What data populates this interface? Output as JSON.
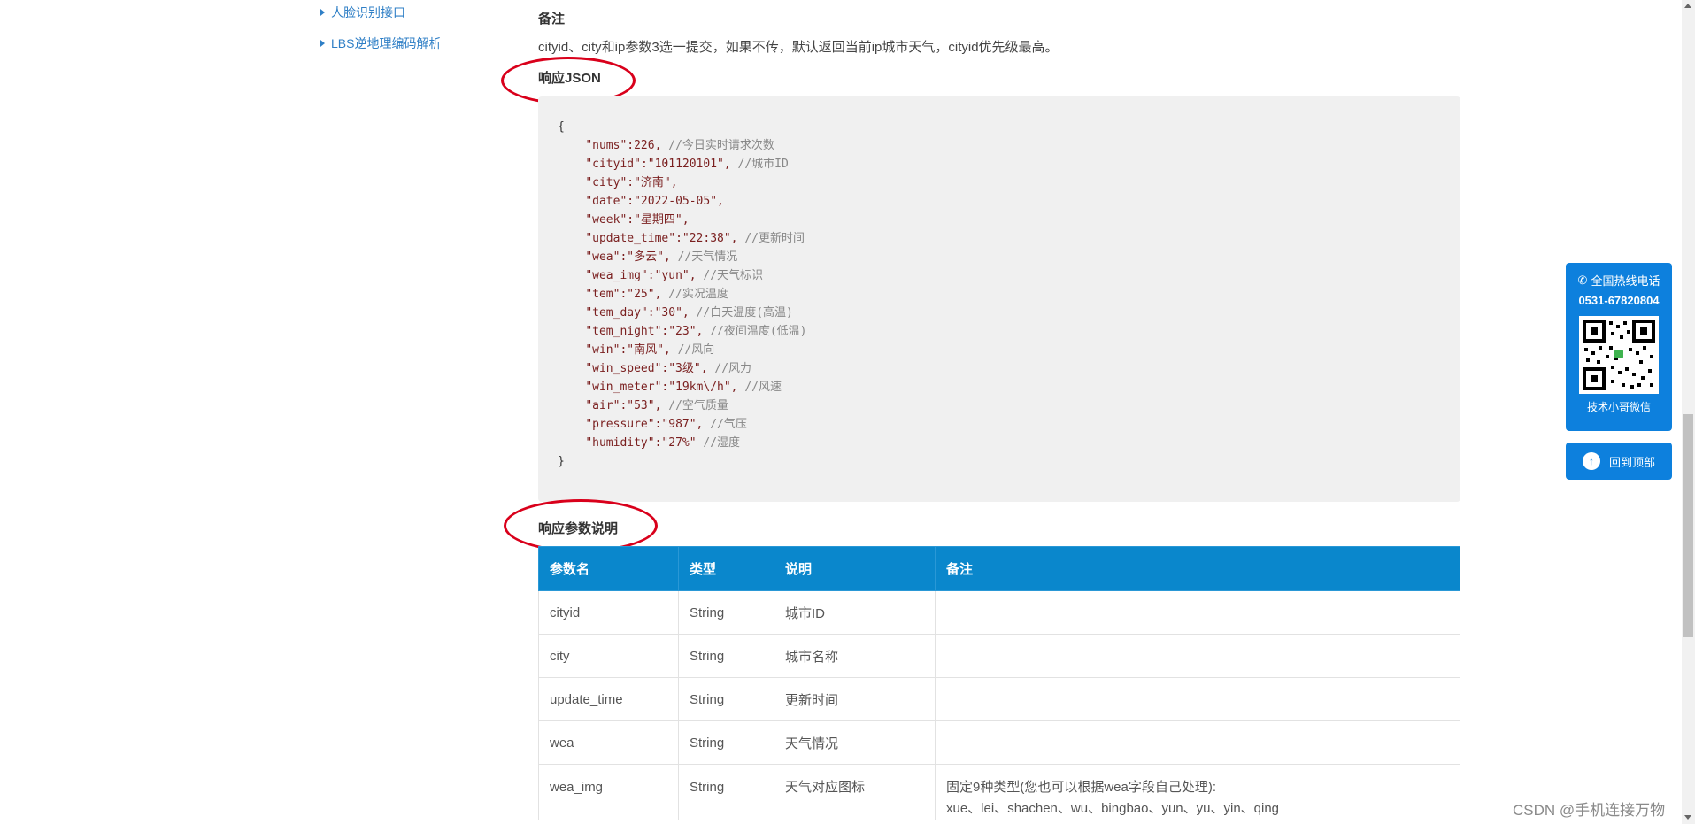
{
  "sidebar": {
    "items": [
      {
        "label": "人脸识别接口"
      },
      {
        "label": "LBS逆地理编码解析"
      }
    ]
  },
  "remark": {
    "heading": "备注",
    "text": "cityid、city和ip参数3选一提交，如果不传，默认返回当前ip城市天气，cityid优先级最高。"
  },
  "response_json": {
    "title": "响应JSON",
    "open_brace": "{",
    "close_brace": "}",
    "lines": [
      {
        "key": "\"nums\"",
        "value": ":226,",
        "comment": " //今日实时请求次数"
      },
      {
        "key": "\"cityid\"",
        "value": ":\"101120101\",",
        "comment": " //城市ID"
      },
      {
        "key": "\"city\"",
        "value": ":\"济南\",",
        "comment": ""
      },
      {
        "key": "\"date\"",
        "value": ":\"2022-05-05\",",
        "comment": ""
      },
      {
        "key": "\"week\"",
        "value": ":\"星期四\",",
        "comment": ""
      },
      {
        "key": "\"update_time\"",
        "value": ":\"22:38\",",
        "comment": " //更新时间"
      },
      {
        "key": "\"wea\"",
        "value": ":\"多云\",",
        "comment": " //天气情况"
      },
      {
        "key": "\"wea_img\"",
        "value": ":\"yun\",",
        "comment": " //天气标识"
      },
      {
        "key": "\"tem\"",
        "value": ":\"25\",",
        "comment": " //实况温度"
      },
      {
        "key": "\"tem_day\"",
        "value": ":\"30\",",
        "comment": " //白天温度(高温)"
      },
      {
        "key": "\"tem_night\"",
        "value": ":\"23\",",
        "comment": " //夜间温度(低温)"
      },
      {
        "key": "\"win\"",
        "value": ":\"南风\",",
        "comment": " //风向"
      },
      {
        "key": "\"win_speed\"",
        "value": ":\"3级\",",
        "comment": " //风力"
      },
      {
        "key": "\"win_meter\"",
        "value": ":\"19km\\/h\",",
        "comment": " //风速"
      },
      {
        "key": "\"air\"",
        "value": ":\"53\",",
        "comment": " //空气质量"
      },
      {
        "key": "\"pressure\"",
        "value": ":\"987\",",
        "comment": " //气压"
      },
      {
        "key": "\"humidity\"",
        "value": ":\"27%\"",
        "comment": " //湿度"
      }
    ]
  },
  "response_params": {
    "title": "响应参数说明",
    "headers": [
      "参数名",
      "类型",
      "说明",
      "备注"
    ],
    "rows": [
      [
        "cityid",
        "String",
        "城市ID",
        ""
      ],
      [
        "city",
        "String",
        "城市名称",
        ""
      ],
      [
        "update_time",
        "String",
        "更新时间",
        ""
      ],
      [
        "wea",
        "String",
        "天气情况",
        ""
      ],
      [
        "wea_img",
        "String",
        "天气对应图标",
        "固定9种类型(您也可以根据wea字段自己处理):\nxue、lei、shachen、wu、bingbao、yun、yu、yin、qing"
      ]
    ]
  },
  "float_widget": {
    "hotline_label": "全国热线电话",
    "hotline_number": "0531-67820804",
    "qr_caption": "技术小哥微信",
    "back_to_top": "回到顶部",
    "phone_icon": "phone-icon",
    "up_icon": "arrow-up-icon"
  },
  "watermark": "CSDN @手机连接万物",
  "colors": {
    "accent": "#0a87cc",
    "widget": "#0d80dd",
    "annotation": "#d9001b",
    "link": "#2f7fc6"
  }
}
